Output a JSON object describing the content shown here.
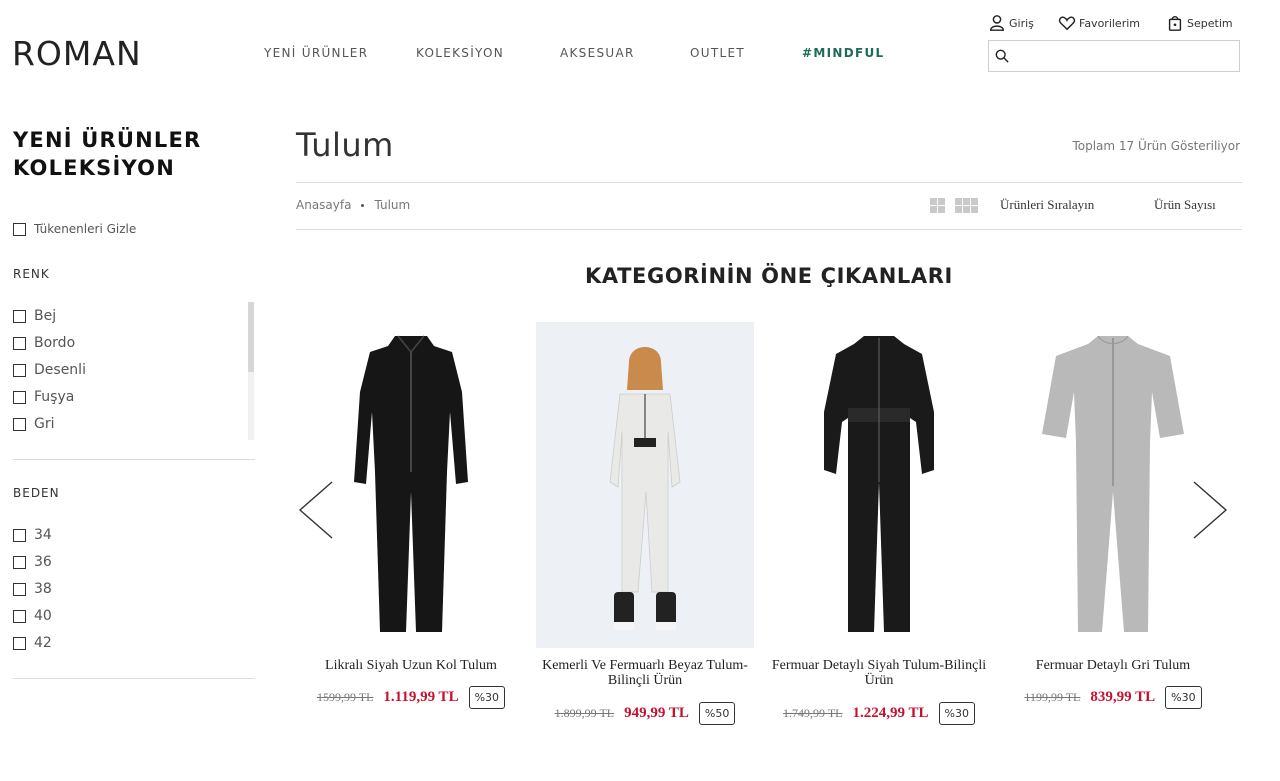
{
  "header": {
    "logo": "ROMAN",
    "nav": [
      "YENİ ÜRÜNLER",
      "KOLEKSİYON",
      "AKSESUAR",
      "OUTLET",
      "#MINDFUL"
    ],
    "login": "Giriş",
    "favorites": "Favorilerim",
    "cart": "Sepetim",
    "search_value": ""
  },
  "sidebar": {
    "title_line1": "YENİ ÜRÜNLER",
    "title_line2": "KOLEKSİYON",
    "hide_sold_out": "Tükenenleri Gizle",
    "color_label": "RENK",
    "colors": [
      "Bej",
      "Bordo",
      "Desenli",
      "Fuşya",
      "Gri"
    ],
    "size_label": "BEDEN",
    "sizes": [
      "34",
      "36",
      "38",
      "40",
      "42"
    ]
  },
  "main": {
    "title": "Tulum",
    "total": "Toplam 17 Ürün Gösteriliyor",
    "breadcrumb": [
      "Anasayfa",
      "Tulum"
    ],
    "sort_label": "Ürünleri Sıralayın",
    "count_label": "Ürün Sayısı",
    "featured_heading": "KATEGORİNİN ÖNE ÇIKANLARI"
  },
  "products": [
    {
      "name": "Likralı Siyah Uzun Kol Tulum",
      "old_price": "1599,99 TL",
      "new_price": "1.119,99 TL",
      "discount": "%30",
      "color": "#161616"
    },
    {
      "name": "Kemerli Ve Fermuarlı Beyaz Tulum-Bilinçli Ürün",
      "old_price": "1.899,99 TL",
      "new_price": "949,99 TL",
      "discount": "%50",
      "color": "#e9e9e7"
    },
    {
      "name": "Fermuar Detaylı Siyah Tulum-Bilinçli Ürün",
      "old_price": "1.749,99 TL",
      "new_price": "1.224,99 TL",
      "discount": "%30",
      "color": "#1a1a1a"
    },
    {
      "name": "Fermuar Detaylı Gri Tulum",
      "old_price": "1199,99 TL",
      "new_price": "839,99 TL",
      "discount": "%30",
      "color": "#b9b9b9"
    }
  ],
  "icons": {
    "login": "user-icon",
    "favorites": "heart-icon",
    "cart": "bag-icon",
    "search": "search-icon",
    "prev": "chevron-left-icon",
    "next": "chevron-right-icon"
  },
  "colors": {
    "accent_green": "#1f6b57",
    "price_red": "#c8102e"
  }
}
